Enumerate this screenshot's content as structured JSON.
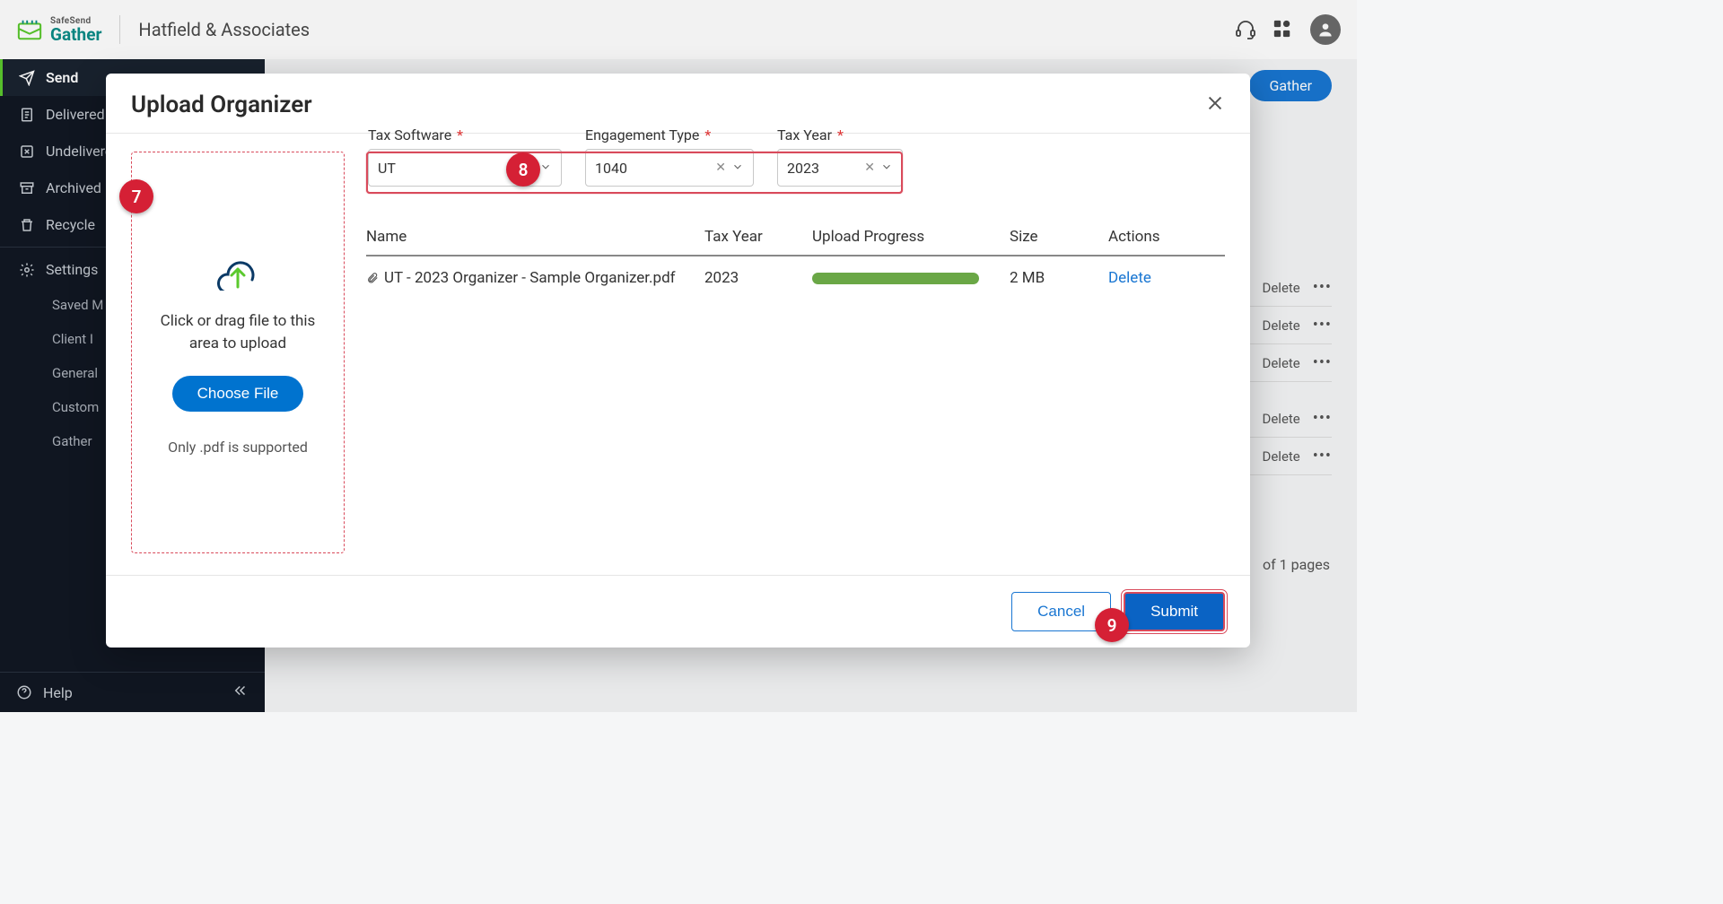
{
  "header": {
    "logo_safesend": "SafeSend",
    "logo_gather": "Gather",
    "company": "Hatfield & Associates"
  },
  "sidebar": {
    "items": [
      {
        "label": "Send"
      },
      {
        "label": "Delivered"
      },
      {
        "label": "Undelivered"
      },
      {
        "label": "Archived"
      },
      {
        "label": "Recycle"
      },
      {
        "label": "Settings"
      }
    ],
    "sub_items": [
      {
        "label": "Saved M"
      },
      {
        "label": "Client I"
      },
      {
        "label": "General"
      },
      {
        "label": "Custom"
      },
      {
        "label": "Gather"
      }
    ],
    "help": "Help"
  },
  "background": {
    "gather_btn": "Gather",
    "delete_label": "Delete",
    "pages": "of 1  pages"
  },
  "modal": {
    "title": "Upload Organizer",
    "drop_text": "Click or drag file to this area to upload",
    "choose_btn": "Choose File",
    "support_text": "Only .pdf is supported",
    "fields": {
      "tax_software": {
        "label": "Tax Software",
        "value": "UT"
      },
      "engagement_type": {
        "label": "Engagement Type",
        "value": "1040"
      },
      "tax_year": {
        "label": "Tax Year",
        "value": "2023"
      }
    },
    "table": {
      "headers": {
        "name": "Name",
        "tax_year": "Tax Year",
        "progress": "Upload Progress",
        "size": "Size",
        "actions": "Actions"
      },
      "row": {
        "name": "UT - 2023 Organizer - Sample Organizer.pdf",
        "tax_year": "2023",
        "size": "2 MB",
        "delete": "Delete"
      }
    },
    "footer": {
      "cancel": "Cancel",
      "submit": "Submit"
    }
  },
  "badges": {
    "b7": "7",
    "b8": "8",
    "b9": "9"
  }
}
